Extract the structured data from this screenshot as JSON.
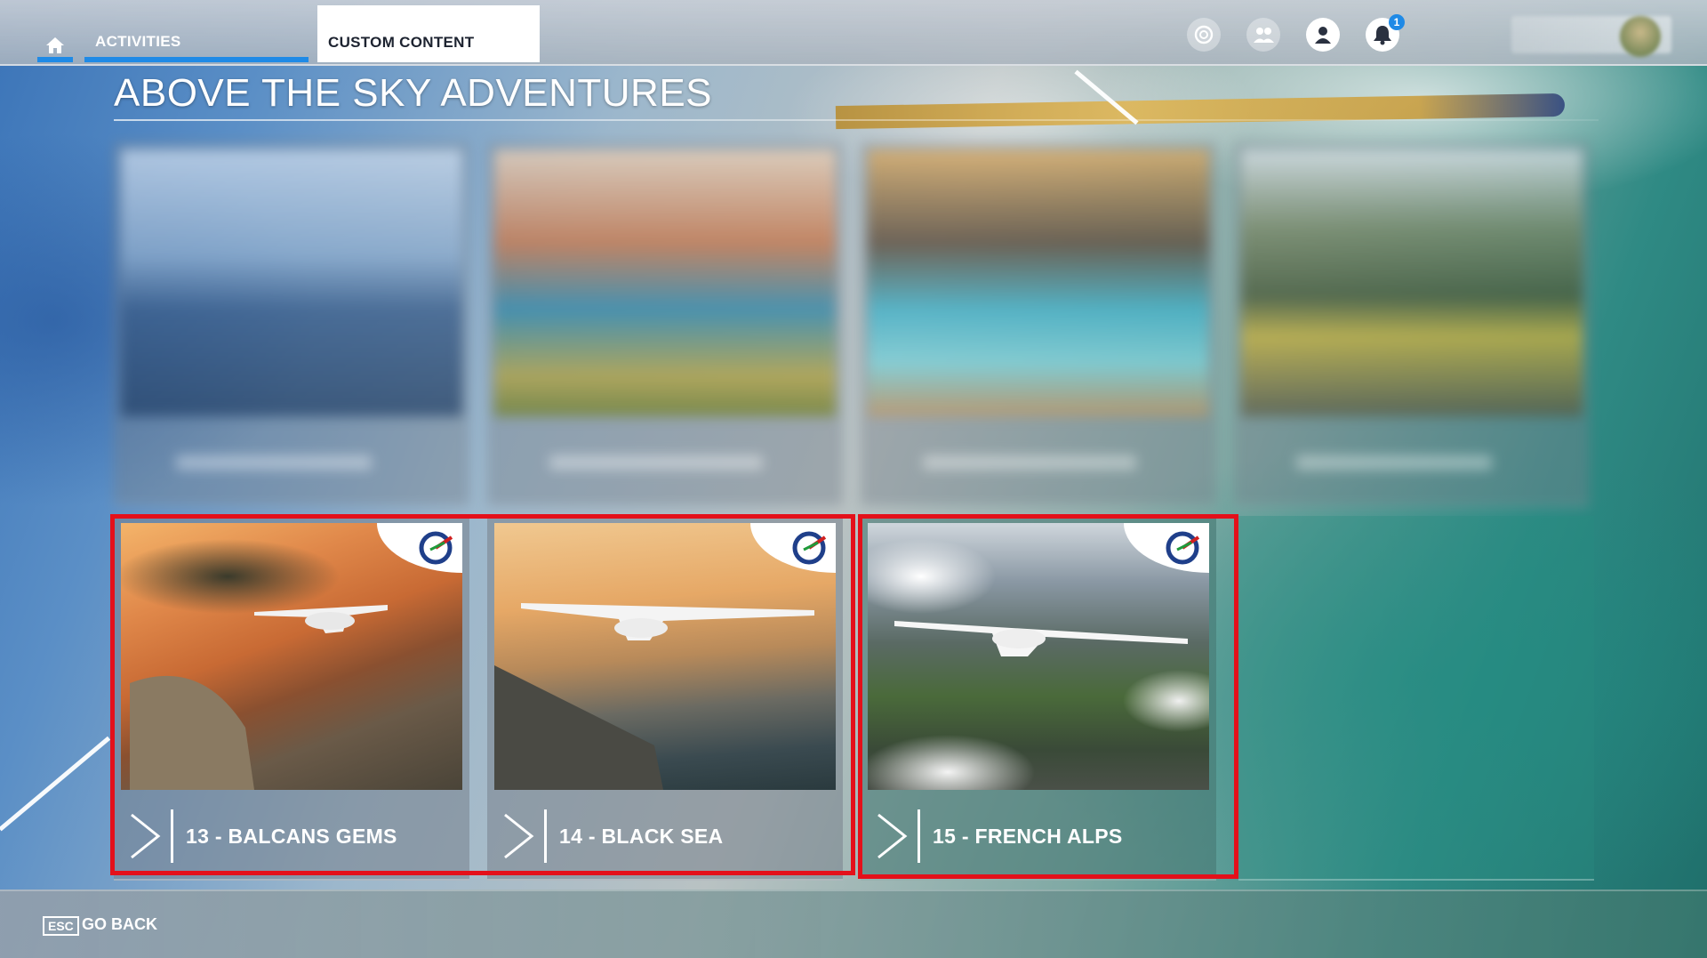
{
  "topbar": {
    "tabs": [
      {
        "label": "ACTIVITIES",
        "active": true
      },
      {
        "label": "CUSTOM CONTENT",
        "active": false
      }
    ],
    "icons": [
      "home-icon",
      "achievements-icon",
      "friends-icon",
      "profile-icon",
      "notifications-icon"
    ],
    "notification_count": "1"
  },
  "page": {
    "title": "ABOVE THE SKY ADVENTURES"
  },
  "cards_top_row_blurred": 4,
  "cards": [
    {
      "label": "13 - BALCANS GEMS",
      "icon": "chevron-right-icon",
      "highlighted": true
    },
    {
      "label": "14 - BLACK SEA",
      "icon": "chevron-right-icon",
      "highlighted": true
    },
    {
      "label": "15 - FRENCH ALPS",
      "icon": "chevron-right-icon",
      "highlighted": true
    }
  ],
  "bottombar": {
    "key": "ESC",
    "action": "GO BACK"
  },
  "colors": {
    "accent_blue": "#1f8ae6",
    "highlight_red": "#e4101a",
    "tab_active_bg": "#ffffff"
  }
}
